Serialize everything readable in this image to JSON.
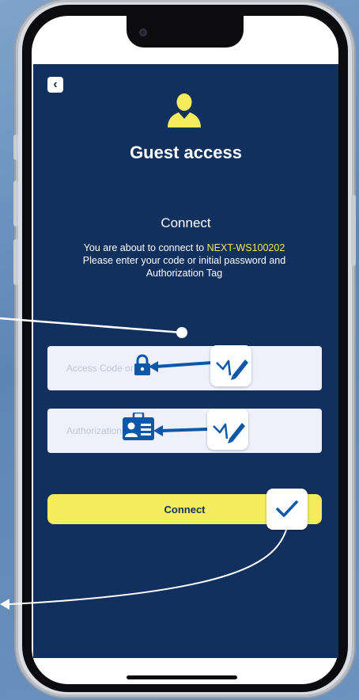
{
  "header": {
    "back_icon": "chevron-left-icon",
    "back_glyph": "‹",
    "user_icon": "user-icon"
  },
  "main": {
    "title": "Guest access",
    "subtitle": "Connect",
    "message_prefix": "You are about to connect to ",
    "network_name": "NEXT-WS100202",
    "message_line2": "Please enter your code or initial password and",
    "message_line3": "Authorization Tag"
  },
  "form": {
    "access_code": {
      "value": "",
      "placeholder": "Access Code or P..."
    },
    "authorization_tag": {
      "value": "",
      "placeholder": "Authorization Tag"
    },
    "connect_label": "Connect"
  },
  "annotations": {
    "lock_icon": "lock-icon",
    "id_card_icon": "id-card-icon",
    "pen_icon": "pen-icon",
    "check_icon": "checkmark-icon"
  },
  "colors": {
    "app_background": "#11305e",
    "accent_yellow": "#f4ec5a",
    "highlight_text": "#f2e85a",
    "field_background": "#eef1fb",
    "icon_blue": "#0b58a8"
  }
}
